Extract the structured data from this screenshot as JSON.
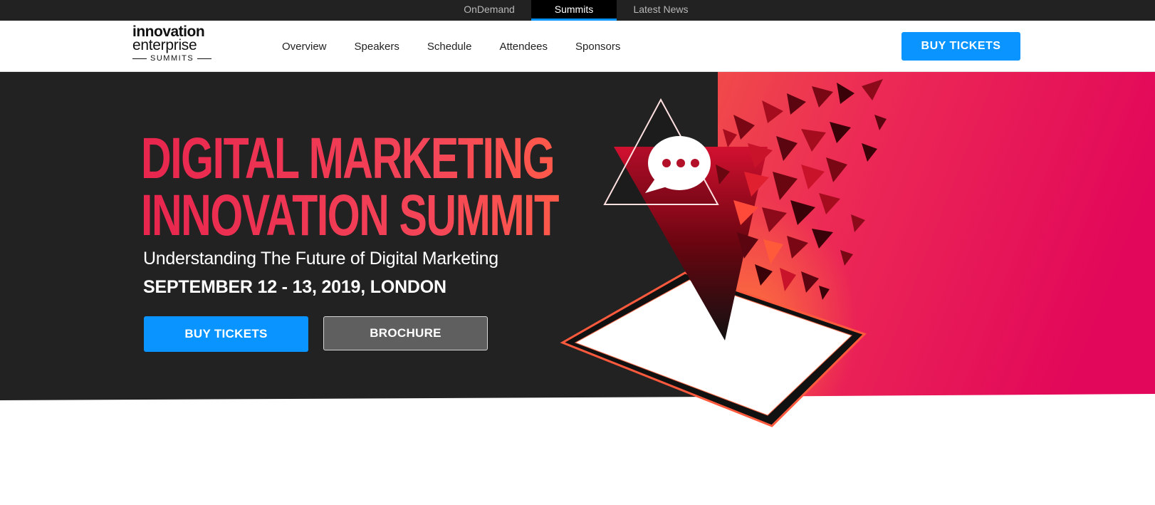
{
  "top_nav": {
    "tabs": [
      {
        "label": "OnDemand",
        "active": false
      },
      {
        "label": "Summits",
        "active": true
      },
      {
        "label": "Latest News",
        "active": false
      }
    ]
  },
  "header": {
    "logo": {
      "line1": "innovation",
      "line2": "enterprise",
      "line3": "SUMMITS"
    },
    "nav": [
      "Overview",
      "Speakers",
      "Schedule",
      "Attendees",
      "Sponsors"
    ],
    "cta": "BUY  TICKETS"
  },
  "hero": {
    "title_line1": "DIGITAL MARKETING",
    "title_line2": "INNOVATION SUMMIT",
    "subtitle": "Understanding The Future of Digital Marketing",
    "date": "SEPTEMBER 12 - 13, 2019, LONDON",
    "buy_button": "BUY TICKETS",
    "brochure_button": "BROCHURE"
  },
  "colors": {
    "topbar": "#222222",
    "accent_blue": "#0a94ff",
    "hero_dark": "#222222",
    "hero_pink": "#e8115a",
    "title_red": "#f03550"
  },
  "icons": [
    "chat-bubble-icon",
    "tablet-illustration",
    "shattered-triangle-graphic"
  ]
}
